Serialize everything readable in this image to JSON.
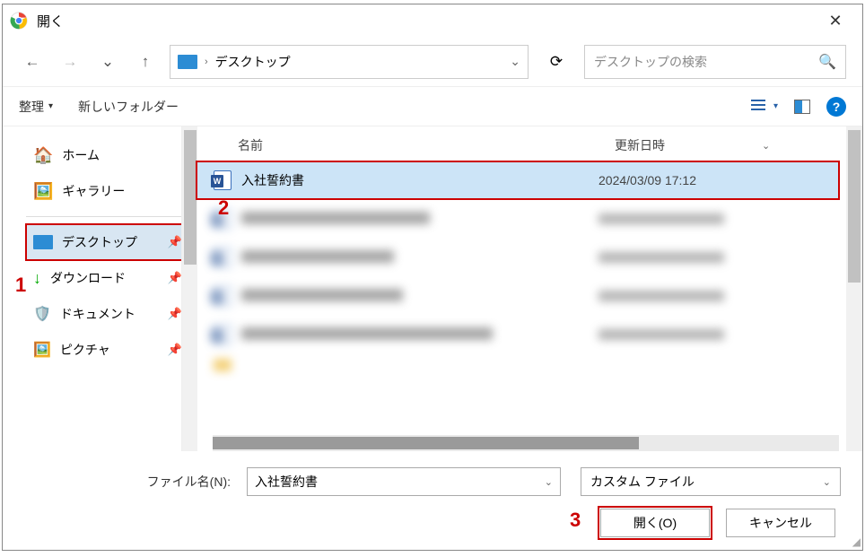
{
  "titlebar": {
    "title": "開く"
  },
  "nav": {
    "breadcrumb_location": "デスクトップ",
    "search_placeholder": "デスクトップの検索"
  },
  "toolbar": {
    "organize": "整理",
    "new_folder": "新しいフォルダー"
  },
  "sidebar": {
    "home": "ホーム",
    "gallery": "ギャラリー",
    "desktop": "デスクトップ",
    "downloads": "ダウンロード",
    "documents": "ドキュメント",
    "pictures": "ピクチャ"
  },
  "filelist": {
    "col_name": "名前",
    "col_date": "更新日時",
    "selected": {
      "name": "入社誓約書",
      "date": "2024/03/09 17:12"
    }
  },
  "footer": {
    "filename_label": "ファイル名(N):",
    "filename_value": "入社誓約書",
    "filetype_value": "カスタム ファイル",
    "open_btn": "開く(O)",
    "cancel_btn": "キャンセル"
  },
  "annotations": {
    "a1": "1",
    "a2": "2",
    "a3": "3"
  }
}
